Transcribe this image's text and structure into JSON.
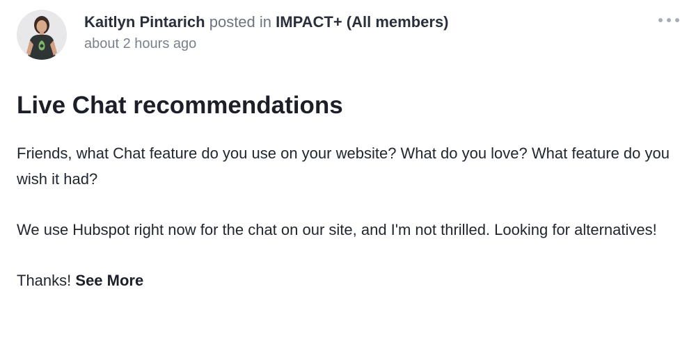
{
  "post": {
    "author": "Kaitlyn Pintarich",
    "posted_in_text": "posted in",
    "group": "IMPACT+ (All members)",
    "timestamp": "about 2 hours ago",
    "title": "Live Chat recommendations",
    "paragraphs": [
      "Friends, what Chat feature do you use on your website? What do you love? What feature do you wish it had?",
      "We use Hubspot right now for the chat on our site, and I'm not thrilled. Looking for alternatives!"
    ],
    "closing": "Thanks!",
    "see_more_label": "See More",
    "more_menu_icon": "more-horizontal-icon"
  }
}
